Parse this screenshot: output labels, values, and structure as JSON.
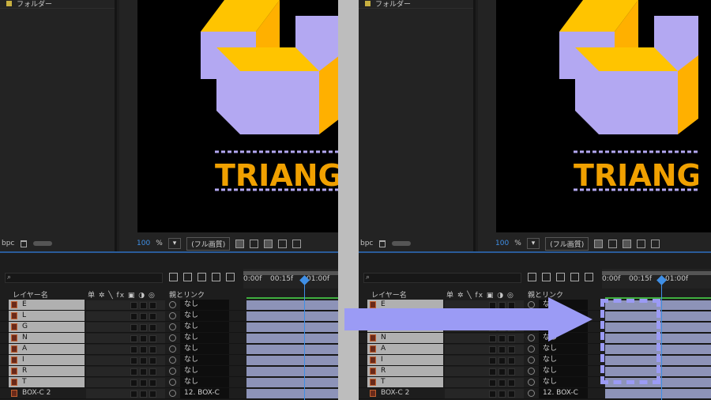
{
  "project": {
    "folder_label": "フォルダー",
    "bpc": "bpc"
  },
  "viewer": {
    "title_text": "TRIANG",
    "zoom": "100",
    "zoom_unit": "%",
    "quality": "(フル画質)"
  },
  "timeline": {
    "search_placeholder": "",
    "header": {
      "layer_name": "レイヤー名",
      "switches": "单 ✲ ╲ fx ▣ ◑ ◎",
      "parent_link": "親とリンク"
    },
    "ruler": {
      "t0": "0:00f",
      "t1": "00:15f",
      "t2": "01:00f"
    },
    "layers": [
      {
        "name": "E",
        "parent": "なし"
      },
      {
        "name": "L",
        "parent": "なし"
      },
      {
        "name": "G",
        "parent": "なし"
      },
      {
        "name": "N",
        "parent": "なし"
      },
      {
        "name": "A",
        "parent": "なし"
      },
      {
        "name": "I",
        "parent": "なし"
      },
      {
        "name": "R",
        "parent": "なし"
      },
      {
        "name": "T",
        "parent": "なし"
      },
      {
        "name": "BOX-C 2",
        "parent": "12. BOX-C"
      }
    ]
  },
  "colors": {
    "accent": "#3f8fe6",
    "overlay": "#9b9bf5",
    "clip_bar": "#8d93b8",
    "shape_yellow": "#ffc400",
    "shape_lavender": "#b3a8f2"
  }
}
